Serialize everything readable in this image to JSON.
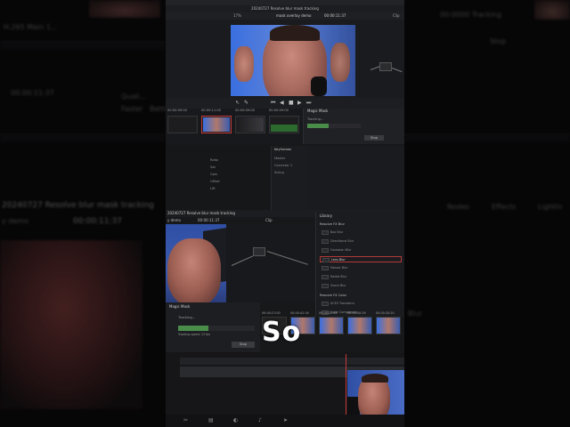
{
  "background": {
    "left": {
      "project_title": "20240727 Resolve blur mask tracking",
      "demo_label": "y demo",
      "timecode": "00:00:11:37",
      "clip_name": "H.265 Main 1...",
      "side_labels": [
        "Quali...",
        "Faster",
        "Better"
      ]
    },
    "right": {
      "tracking_text": "00:0000 Tracking",
      "stop_label": "Stop",
      "nodes_label": "Nodes",
      "effects_label": "Effects",
      "lighting_label": "Lightin",
      "blur_label": "Blur"
    }
  },
  "menubar": {
    "items": [
      "File",
      "Edit",
      "Trim",
      "Timeline",
      "Clip",
      "Mark",
      "View",
      "Playback",
      "Fusion",
      "Color",
      "Fairlight",
      "Workspace",
      "Help"
    ]
  },
  "titlebar": {
    "title": "20240727 Resolve blur mask tracking"
  },
  "viewer_toolbar": {
    "zoom": "17%",
    "clip_label": "mask overlay demo",
    "timecode": "00:00:11:37",
    "clip_menu": "Clip"
  },
  "thumbs_top": [
    {
      "tc": "00:00:09:00"
    },
    {
      "tc": "00:00:11:00"
    },
    {
      "tc": "00:00:09:00"
    },
    {
      "tc": "00:00:09:00"
    }
  ],
  "magic_mask_small": {
    "title": "Magic Mask",
    "status": "Tracking...",
    "detail": "Tracking speed: 23 fps",
    "stop": "Stop"
  },
  "color_panel": {
    "keyframes_title": "Keyframes",
    "table_labels": [
      "Ratio",
      "Sat",
      "Gain",
      "Offset",
      "Lift"
    ],
    "rows": [
      "Master",
      "Corrector 1",
      "Sizing"
    ]
  },
  "lower": {
    "project_title": "20240727 Resolve blur mask tracking",
    "demo_label": "y demo",
    "timecode": "00:00:11:37",
    "clip_menu": "Clip",
    "tabs": [
      "Nodes",
      "Effects"
    ],
    "library": {
      "title": "Library",
      "section1": "Resolve FX Blur",
      "items": [
        "Box Blur",
        "Directional Blur",
        "Gaussian Blur",
        "Lens Blur",
        "Mosaic Blur",
        "Radial Blur",
        "Zoom Blur"
      ],
      "selected_index": 3,
      "section2": "Resolve FX Color",
      "items2": [
        "ACES Transform",
        "Color Compressor"
      ]
    },
    "magic_mask": {
      "title": "Magic Mask",
      "status": "Tracking...",
      "detail": "Tracking speed: 13 fps",
      "detail2": "Remaining: 00:00:04",
      "stop": "Stop",
      "progress": 0.4
    },
    "thumbs": [
      {
        "tc": "00:00:27:00"
      },
      {
        "tc": "00:00:42:16"
      },
      {
        "tc": "00:00:22:40"
      },
      {
        "tc": "00:00:40:39"
      },
      {
        "tc": "00:00:35:20"
      }
    ],
    "caption": "So"
  },
  "colors": {
    "accent_red": "#c43a3a",
    "progress_green": "#4a8c4a"
  },
  "page_icons": [
    "cut-icon",
    "edit-icon",
    "color-icon",
    "fairlight-icon",
    "deliver-icon"
  ]
}
